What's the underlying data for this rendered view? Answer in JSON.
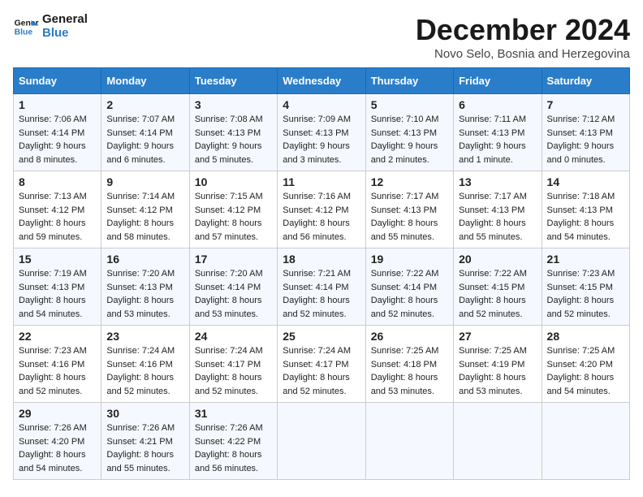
{
  "header": {
    "logo_line1": "General",
    "logo_line2": "Blue",
    "month_title": "December 2024",
    "location": "Novo Selo, Bosnia and Herzegovina"
  },
  "days_of_week": [
    "Sunday",
    "Monday",
    "Tuesday",
    "Wednesday",
    "Thursday",
    "Friday",
    "Saturday"
  ],
  "weeks": [
    [
      {
        "day": "1",
        "sunrise": "Sunrise: 7:06 AM",
        "sunset": "Sunset: 4:14 PM",
        "daylight": "Daylight: 9 hours and 8 minutes."
      },
      {
        "day": "2",
        "sunrise": "Sunrise: 7:07 AM",
        "sunset": "Sunset: 4:14 PM",
        "daylight": "Daylight: 9 hours and 6 minutes."
      },
      {
        "day": "3",
        "sunrise": "Sunrise: 7:08 AM",
        "sunset": "Sunset: 4:13 PM",
        "daylight": "Daylight: 9 hours and 5 minutes."
      },
      {
        "day": "4",
        "sunrise": "Sunrise: 7:09 AM",
        "sunset": "Sunset: 4:13 PM",
        "daylight": "Daylight: 9 hours and 3 minutes."
      },
      {
        "day": "5",
        "sunrise": "Sunrise: 7:10 AM",
        "sunset": "Sunset: 4:13 PM",
        "daylight": "Daylight: 9 hours and 2 minutes."
      },
      {
        "day": "6",
        "sunrise": "Sunrise: 7:11 AM",
        "sunset": "Sunset: 4:13 PM",
        "daylight": "Daylight: 9 hours and 1 minute."
      },
      {
        "day": "7",
        "sunrise": "Sunrise: 7:12 AM",
        "sunset": "Sunset: 4:13 PM",
        "daylight": "Daylight: 9 hours and 0 minutes."
      }
    ],
    [
      {
        "day": "8",
        "sunrise": "Sunrise: 7:13 AM",
        "sunset": "Sunset: 4:12 PM",
        "daylight": "Daylight: 8 hours and 59 minutes."
      },
      {
        "day": "9",
        "sunrise": "Sunrise: 7:14 AM",
        "sunset": "Sunset: 4:12 PM",
        "daylight": "Daylight: 8 hours and 58 minutes."
      },
      {
        "day": "10",
        "sunrise": "Sunrise: 7:15 AM",
        "sunset": "Sunset: 4:12 PM",
        "daylight": "Daylight: 8 hours and 57 minutes."
      },
      {
        "day": "11",
        "sunrise": "Sunrise: 7:16 AM",
        "sunset": "Sunset: 4:12 PM",
        "daylight": "Daylight: 8 hours and 56 minutes."
      },
      {
        "day": "12",
        "sunrise": "Sunrise: 7:17 AM",
        "sunset": "Sunset: 4:13 PM",
        "daylight": "Daylight: 8 hours and 55 minutes."
      },
      {
        "day": "13",
        "sunrise": "Sunrise: 7:17 AM",
        "sunset": "Sunset: 4:13 PM",
        "daylight": "Daylight: 8 hours and 55 minutes."
      },
      {
        "day": "14",
        "sunrise": "Sunrise: 7:18 AM",
        "sunset": "Sunset: 4:13 PM",
        "daylight": "Daylight: 8 hours and 54 minutes."
      }
    ],
    [
      {
        "day": "15",
        "sunrise": "Sunrise: 7:19 AM",
        "sunset": "Sunset: 4:13 PM",
        "daylight": "Daylight: 8 hours and 54 minutes."
      },
      {
        "day": "16",
        "sunrise": "Sunrise: 7:20 AM",
        "sunset": "Sunset: 4:13 PM",
        "daylight": "Daylight: 8 hours and 53 minutes."
      },
      {
        "day": "17",
        "sunrise": "Sunrise: 7:20 AM",
        "sunset": "Sunset: 4:14 PM",
        "daylight": "Daylight: 8 hours and 53 minutes."
      },
      {
        "day": "18",
        "sunrise": "Sunrise: 7:21 AM",
        "sunset": "Sunset: 4:14 PM",
        "daylight": "Daylight: 8 hours and 52 minutes."
      },
      {
        "day": "19",
        "sunrise": "Sunrise: 7:22 AM",
        "sunset": "Sunset: 4:14 PM",
        "daylight": "Daylight: 8 hours and 52 minutes."
      },
      {
        "day": "20",
        "sunrise": "Sunrise: 7:22 AM",
        "sunset": "Sunset: 4:15 PM",
        "daylight": "Daylight: 8 hours and 52 minutes."
      },
      {
        "day": "21",
        "sunrise": "Sunrise: 7:23 AM",
        "sunset": "Sunset: 4:15 PM",
        "daylight": "Daylight: 8 hours and 52 minutes."
      }
    ],
    [
      {
        "day": "22",
        "sunrise": "Sunrise: 7:23 AM",
        "sunset": "Sunset: 4:16 PM",
        "daylight": "Daylight: 8 hours and 52 minutes."
      },
      {
        "day": "23",
        "sunrise": "Sunrise: 7:24 AM",
        "sunset": "Sunset: 4:16 PM",
        "daylight": "Daylight: 8 hours and 52 minutes."
      },
      {
        "day": "24",
        "sunrise": "Sunrise: 7:24 AM",
        "sunset": "Sunset: 4:17 PM",
        "daylight": "Daylight: 8 hours and 52 minutes."
      },
      {
        "day": "25",
        "sunrise": "Sunrise: 7:24 AM",
        "sunset": "Sunset: 4:17 PM",
        "daylight": "Daylight: 8 hours and 52 minutes."
      },
      {
        "day": "26",
        "sunrise": "Sunrise: 7:25 AM",
        "sunset": "Sunset: 4:18 PM",
        "daylight": "Daylight: 8 hours and 53 minutes."
      },
      {
        "day": "27",
        "sunrise": "Sunrise: 7:25 AM",
        "sunset": "Sunset: 4:19 PM",
        "daylight": "Daylight: 8 hours and 53 minutes."
      },
      {
        "day": "28",
        "sunrise": "Sunrise: 7:25 AM",
        "sunset": "Sunset: 4:20 PM",
        "daylight": "Daylight: 8 hours and 54 minutes."
      }
    ],
    [
      {
        "day": "29",
        "sunrise": "Sunrise: 7:26 AM",
        "sunset": "Sunset: 4:20 PM",
        "daylight": "Daylight: 8 hours and 54 minutes."
      },
      {
        "day": "30",
        "sunrise": "Sunrise: 7:26 AM",
        "sunset": "Sunset: 4:21 PM",
        "daylight": "Daylight: 8 hours and 55 minutes."
      },
      {
        "day": "31",
        "sunrise": "Sunrise: 7:26 AM",
        "sunset": "Sunset: 4:22 PM",
        "daylight": "Daylight: 8 hours and 56 minutes."
      },
      {
        "day": "",
        "sunrise": "",
        "sunset": "",
        "daylight": ""
      },
      {
        "day": "",
        "sunrise": "",
        "sunset": "",
        "daylight": ""
      },
      {
        "day": "",
        "sunrise": "",
        "sunset": "",
        "daylight": ""
      },
      {
        "day": "",
        "sunrise": "",
        "sunset": "",
        "daylight": ""
      }
    ]
  ]
}
